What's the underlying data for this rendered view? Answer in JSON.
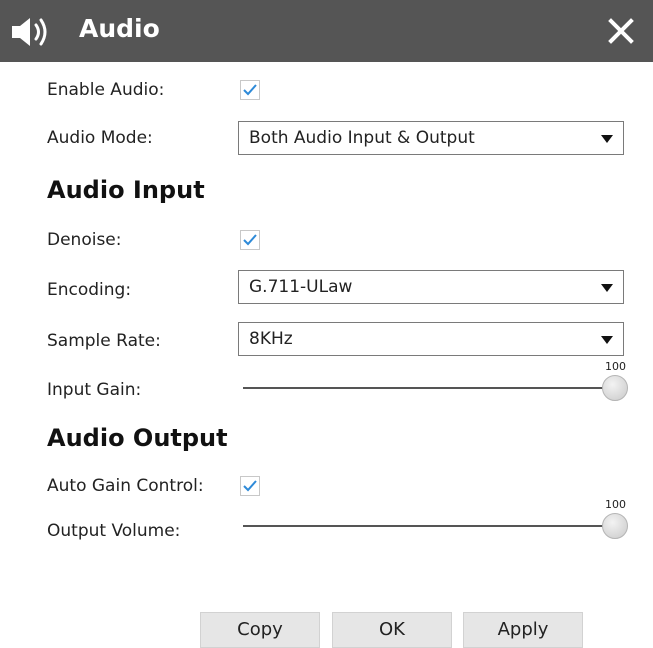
{
  "dialog": {
    "title": "Audio",
    "icon": "speaker-icon",
    "close_icon": "close-icon"
  },
  "general": {
    "enable_audio": {
      "label": "Enable Audio:",
      "checked": true
    },
    "audio_mode": {
      "label": "Audio Mode:",
      "value": "Both Audio Input & Output"
    }
  },
  "audio_input": {
    "heading": "Audio Input",
    "denoise": {
      "label": "Denoise:",
      "checked": true
    },
    "encoding": {
      "label": "Encoding:",
      "value": "G.711-ULaw"
    },
    "sample_rate": {
      "label": "Sample Rate:",
      "value": "8KHz"
    },
    "input_gain": {
      "label": "Input Gain:",
      "value": "100",
      "level": 1.0
    }
  },
  "audio_output": {
    "heading": "Audio Output",
    "auto_gain_control": {
      "label": "Auto Gain Control:",
      "checked": true
    },
    "output_volume": {
      "label": "Output Volume:",
      "value": "100",
      "level": 1.0
    }
  },
  "buttons": {
    "copy": "Copy",
    "ok": "OK",
    "apply": "Apply"
  },
  "colors": {
    "titlebar": "#555555",
    "checkmark": "#2e8ad8",
    "button_bg": "#e6e6e6"
  }
}
